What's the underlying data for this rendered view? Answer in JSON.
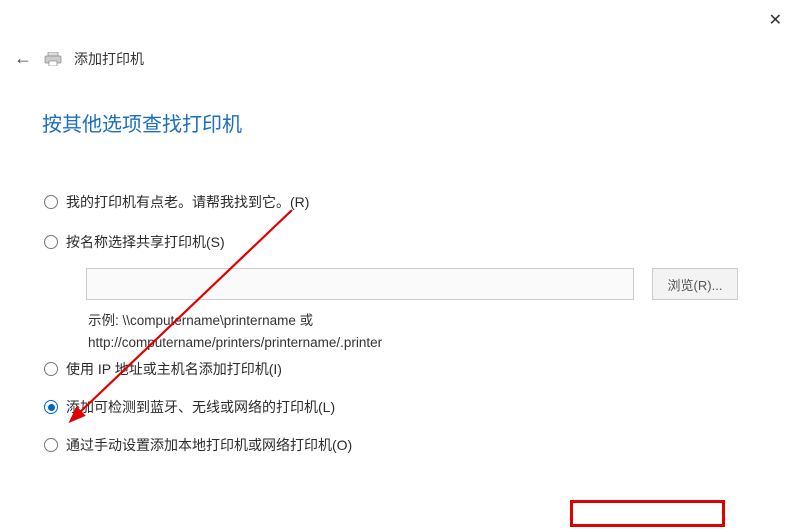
{
  "close_label": "✕",
  "header": {
    "back_glyph": "←",
    "title": "添加打印机"
  },
  "page_title": "按其他选项查找打印机",
  "options": {
    "opt1": "我的打印机有点老。请帮我找到它。(R)",
    "opt2": "按名称选择共享打印机(S)",
    "opt3": "使用 IP 地址或主机名添加打印机(I)",
    "opt4": "添加可检测到蓝牙、无线或网络的打印机(L)",
    "opt5": "通过手动设置添加本地打印机或网络打印机(O)"
  },
  "share": {
    "input_value": "",
    "browse_label": "浏览(R)...",
    "example_line1": "示例: \\\\computername\\printername 或",
    "example_line2": "http://computername/printers/printername/.printer"
  }
}
